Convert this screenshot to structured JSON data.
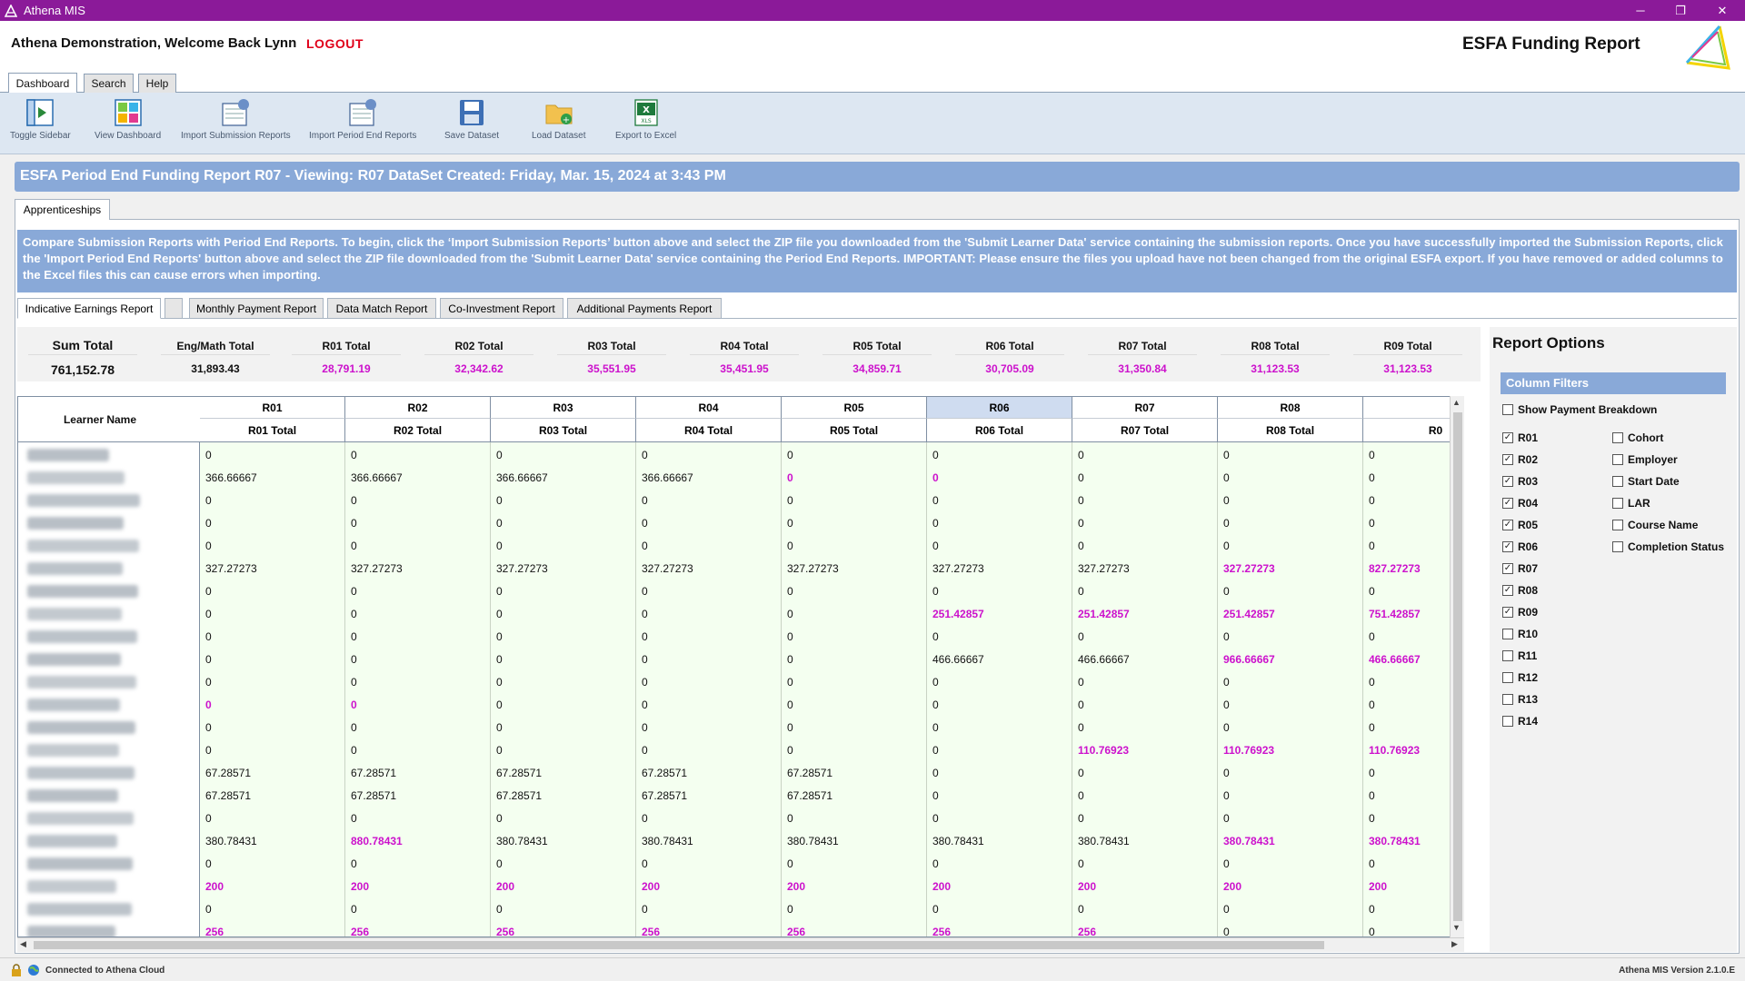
{
  "window": {
    "title": "Athena MIS",
    "minimize": "─",
    "maximize": "❐",
    "close": "✕"
  },
  "header": {
    "welcome": "Athena Demonstration,  Welcome Back Lynn",
    "logout": "LOGOUT",
    "report_title": "ESFA Funding Report"
  },
  "menu_tabs": [
    {
      "label": "Dashboard",
      "active": true
    },
    {
      "label": "Search",
      "active": false
    },
    {
      "label": "Help",
      "active": false
    }
  ],
  "toolbar": [
    {
      "label": "Toggle Sidebar",
      "icon": "toggle-sidebar-icon"
    },
    {
      "label": "View Dashboard",
      "icon": "dashboard-icon"
    },
    {
      "label": "Import Submission Reports",
      "icon": "import-icon"
    },
    {
      "label": "Import Period End Reports",
      "icon": "import-icon"
    },
    {
      "label": "Save Dataset",
      "icon": "floppy-disk-icon"
    },
    {
      "label": "Load Dataset",
      "icon": "folder-icon"
    },
    {
      "label": "Export to Excel",
      "icon": "excel-icon"
    }
  ],
  "banner": "ESFA Period End Funding Report R07   - Viewing: R07 DataSet Created: Friday, Mar. 15, 2024 at 3:43 PM",
  "outer_tab": "Apprenticeships",
  "info_text": "Compare Submission Reports with Period End Reports. To begin, click the ‘Import Submission Reports’ button above and select the ZIP file you downloaded from the 'Submit Learner Data' service containing the submission reports. Once you have successfully imported the Submission Reports, click the 'Import Period End Reports' button above and select the ZIP file downloaded from the 'Submit Learner Data' service containing the Period End Reports. IMPORTANT: Please ensure the files you upload have not been changed from the original ESFA export. If you have removed or added columns to the Excel files this can cause errors when importing.",
  "sub_tabs": [
    {
      "label": "Indicative Earnings Report",
      "active": true
    },
    {
      "label": "",
      "active": false
    },
    {
      "label": "Monthly Payment Report",
      "active": false
    },
    {
      "label": "Data Match Report",
      "active": false
    },
    {
      "label": "Co-Investment Report",
      "active": false
    },
    {
      "label": "Additional Payments Report",
      "active": false
    }
  ],
  "totals": [
    {
      "label": "Sum Total",
      "value": "761,152.78",
      "mag": false
    },
    {
      "label": "Eng/Math Total",
      "value": "31,893.43",
      "mag": false
    },
    {
      "label": "R01 Total",
      "value": "28,791.19",
      "mag": true
    },
    {
      "label": "R02 Total",
      "value": "32,342.62",
      "mag": true
    },
    {
      "label": "R03 Total",
      "value": "35,551.95",
      "mag": true
    },
    {
      "label": "R04 Total",
      "value": "35,451.95",
      "mag": true
    },
    {
      "label": "R05 Total",
      "value": "34,859.71",
      "mag": true
    },
    {
      "label": "R06 Total",
      "value": "30,705.09",
      "mag": true
    },
    {
      "label": "R07 Total",
      "value": "31,350.84",
      "mag": true
    },
    {
      "label": "R08 Total",
      "value": "31,123.53",
      "mag": true
    },
    {
      "label": "R09 Total",
      "value": "31,123.53",
      "mag": true
    }
  ],
  "grid": {
    "name_header": "Learner Name",
    "columns": [
      {
        "label": "R01",
        "sub": "R01 Total",
        "selected": false
      },
      {
        "label": "R02",
        "sub": "R02 Total",
        "selected": false
      },
      {
        "label": "R03",
        "sub": "R03 Total",
        "selected": false
      },
      {
        "label": "R04",
        "sub": "R04 Total",
        "selected": false
      },
      {
        "label": "R05",
        "sub": "R05 Total",
        "selected": false
      },
      {
        "label": "R06",
        "sub": "R06 Total",
        "selected": true
      },
      {
        "label": "R07",
        "sub": "R07 Total",
        "selected": false
      },
      {
        "label": "R08",
        "sub": "R08 Total",
        "selected": false
      },
      {
        "label": "",
        "sub": "R0",
        "selected": false
      }
    ],
    "rows": [
      [
        "0",
        "0",
        "0",
        "0",
        "0",
        "0",
        "0",
        "0",
        "0"
      ],
      [
        "366.66667",
        "366.66667",
        "366.66667",
        "366.66667",
        "*0",
        "*0",
        "0",
        "0",
        "0"
      ],
      [
        "0",
        "0",
        "0",
        "0",
        "0",
        "0",
        "0",
        "0",
        "0"
      ],
      [
        "0",
        "0",
        "0",
        "0",
        "0",
        "0",
        "0",
        "0",
        "0"
      ],
      [
        "0",
        "0",
        "0",
        "0",
        "0",
        "0",
        "0",
        "0",
        "0"
      ],
      [
        "327.27273",
        "327.27273",
        "327.27273",
        "327.27273",
        "327.27273",
        "327.27273",
        "327.27273",
        "*327.27273",
        "*827.27273"
      ],
      [
        "0",
        "0",
        "0",
        "0",
        "0",
        "0",
        "0",
        "0",
        "0"
      ],
      [
        "0",
        "0",
        "0",
        "0",
        "0",
        "*251.42857",
        "*251.42857",
        "*251.42857",
        "*751.42857"
      ],
      [
        "0",
        "0",
        "0",
        "0",
        "0",
        "0",
        "0",
        "0",
        "0"
      ],
      [
        "0",
        "0",
        "0",
        "0",
        "0",
        "466.66667",
        "466.66667",
        "*966.66667",
        "*466.66667"
      ],
      [
        "0",
        "0",
        "0",
        "0",
        "0",
        "0",
        "0",
        "0",
        "0"
      ],
      [
        "*0",
        "*0",
        "0",
        "0",
        "0",
        "0",
        "0",
        "0",
        "0"
      ],
      [
        "0",
        "0",
        "0",
        "0",
        "0",
        "0",
        "0",
        "0",
        "0"
      ],
      [
        "0",
        "0",
        "0",
        "0",
        "0",
        "0",
        "*110.76923",
        "*110.76923",
        "*110.76923"
      ],
      [
        "67.28571",
        "67.28571",
        "67.28571",
        "67.28571",
        "67.28571",
        "0",
        "0",
        "0",
        "0"
      ],
      [
        "67.28571",
        "67.28571",
        "67.28571",
        "67.28571",
        "67.28571",
        "0",
        "0",
        "0",
        "0"
      ],
      [
        "0",
        "0",
        "0",
        "0",
        "0",
        "0",
        "0",
        "0",
        "0"
      ],
      [
        "380.78431",
        "*880.78431",
        "380.78431",
        "380.78431",
        "380.78431",
        "380.78431",
        "380.78431",
        "*380.78431",
        "*380.78431"
      ],
      [
        "0",
        "0",
        "0",
        "0",
        "0",
        "0",
        "0",
        "0",
        "0"
      ],
      [
        "*200",
        "*200",
        "*200",
        "*200",
        "*200",
        "*200",
        "*200",
        "*200",
        "*200"
      ],
      [
        "0",
        "0",
        "0",
        "0",
        "0",
        "0",
        "0",
        "0",
        "0"
      ],
      [
        "*256",
        "*256",
        "*256",
        "*256",
        "*256",
        "*256",
        "*256",
        "0",
        "0"
      ]
    ]
  },
  "options": {
    "title": "Report Options",
    "filter_header": "Column Filters",
    "show_payment": {
      "label": "Show Payment Breakdown",
      "checked": false
    },
    "left": [
      {
        "label": "R01",
        "checked": true
      },
      {
        "label": "R02",
        "checked": true
      },
      {
        "label": "R03",
        "checked": true
      },
      {
        "label": "R04",
        "checked": true
      },
      {
        "label": "R05",
        "checked": true
      },
      {
        "label": "R06",
        "checked": true
      },
      {
        "label": "R07",
        "checked": true
      },
      {
        "label": "R08",
        "checked": true
      },
      {
        "label": "R09",
        "checked": true
      },
      {
        "label": "R10",
        "checked": false
      },
      {
        "label": "R11",
        "checked": false
      },
      {
        "label": "R12",
        "checked": false
      },
      {
        "label": "R13",
        "checked": false
      },
      {
        "label": "R14",
        "checked": false
      }
    ],
    "right": [
      {
        "label": "Cohort",
        "checked": false
      },
      {
        "label": "Employer",
        "checked": false
      },
      {
        "label": "Start Date",
        "checked": false
      },
      {
        "label": "LAR",
        "checked": false
      },
      {
        "label": "Course Name",
        "checked": false
      },
      {
        "label": "Completion Status",
        "checked": false
      }
    ]
  },
  "status": {
    "connection": "Connected to Athena Cloud",
    "version": "Athena MIS Version 2.1.0.E"
  },
  "colors": {
    "titlebar": "#8b1a99",
    "banner": "#89a9d8",
    "logout": "#e0001a",
    "highlight_value": "#cc11cc",
    "grid_bg": "#f4fff0"
  }
}
